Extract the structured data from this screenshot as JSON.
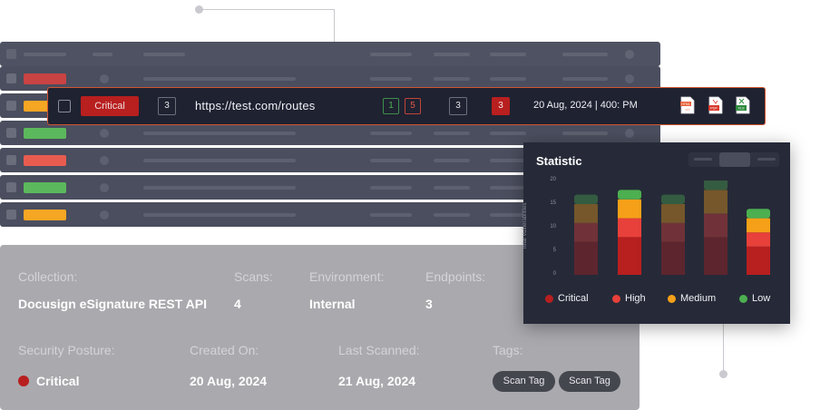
{
  "highlighted_row": {
    "severity": "Critical",
    "count_a": "3",
    "route": "https://test.com/routes",
    "green_count": "1",
    "red_count": "5",
    "count_b": "3",
    "count_c": "3",
    "datetime": "20 Aug, 2024 | 400: PM",
    "export_icons": [
      "html-file-icon",
      "pdf-file-icon",
      "xlsx-file-icon"
    ]
  },
  "background_table": {
    "row_status_colors": [
      "#c94343",
      "#f5a623",
      "#5cb85c",
      "#e85c50",
      "#5cb85c",
      "#f5a623"
    ]
  },
  "info_panel": {
    "collection_label": "Collection:",
    "collection_value": "Docusign eSignature REST API",
    "scans_label": "Scans:",
    "scans_value": "4",
    "environment_label": "Environment:",
    "environment_value": "Internal",
    "endpoints_label": "Endpoints:",
    "endpoints_value": "3",
    "posture_label": "Security Posture:",
    "posture_value": "Critical",
    "created_label": "Created On:",
    "created_value": "20 Aug, 2024",
    "scanned_label": "Last Scanned:",
    "scanned_value": "21 Aug, 2024",
    "tags_label": "Tags:",
    "tags": [
      "Scan Tag",
      "Scan Tag"
    ]
  },
  "statistic": {
    "title": "Statistic",
    "y_axis_label": "Total Vulnerabilities",
    "y_ticks": [
      "20",
      "15",
      "10",
      "5",
      "0"
    ],
    "legend": [
      {
        "label": "Critical",
        "color": "#b81f1f"
      },
      {
        "label": "High",
        "color": "#e8403a"
      },
      {
        "label": "Medium",
        "color": "#f5a018"
      },
      {
        "label": "Low",
        "color": "#4caf50"
      }
    ]
  },
  "chart_data": {
    "type": "bar",
    "stacked": true,
    "ylim": [
      0,
      20
    ],
    "series_order": [
      "Critical",
      "High",
      "Medium",
      "Low"
    ],
    "bars": [
      {
        "values": [
          7,
          4,
          4,
          2
        ],
        "faded": true
      },
      {
        "values": [
          8,
          4,
          4,
          2
        ],
        "faded": false
      },
      {
        "values": [
          7,
          4,
          4,
          2
        ],
        "faded": true
      },
      {
        "values": [
          8,
          5,
          5,
          3
        ],
        "faded": true
      },
      {
        "values": [
          6,
          3,
          3,
          2
        ],
        "faded": false
      }
    ]
  }
}
